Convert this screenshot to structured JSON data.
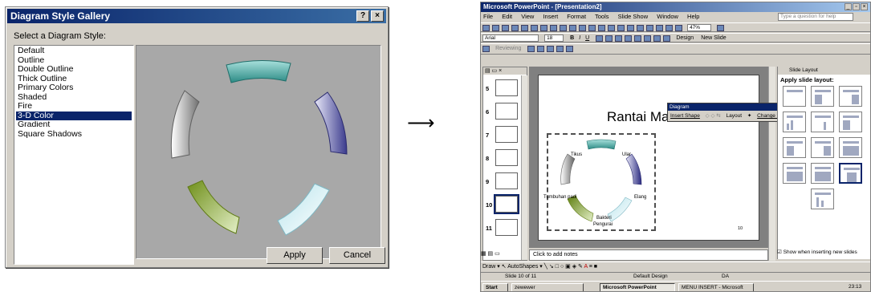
{
  "dialog": {
    "title": "Diagram Style Gallery",
    "help_glyph": "?",
    "close_glyph": "×",
    "prompt": "Select a Diagram Style:",
    "styles": [
      "Default",
      "Outline",
      "Double Outline",
      "Thick Outline",
      "Primary Colors",
      "Shaded",
      "Fire",
      "3-D Color",
      "Gradient",
      "Square Shadows"
    ],
    "selected_style": "3-D Color",
    "apply_label": "Apply",
    "cancel_label": "Cancel"
  },
  "arrow_glyph": "⟶",
  "ppt": {
    "title": "Microsoft PowerPoint - [Presentation2]",
    "window_buttons": [
      "_",
      "▫",
      "×"
    ],
    "menu": [
      "File",
      "Edit",
      "View",
      "Insert",
      "Format",
      "Tools",
      "Slide Show",
      "Window",
      "Help"
    ],
    "help_placeholder": "Type a question for help",
    "zoom": "47%",
    "font_name": "Arial",
    "font_size": "18",
    "design_label": "Design",
    "new_slide_label": "New Slide",
    "reviewing_label": "Reviewing",
    "slide_numbers": [
      "5",
      "6",
      "7",
      "8",
      "9",
      "10",
      "11"
    ],
    "selected_slide": "10",
    "slide": {
      "title": "Rantai Makanan",
      "number": "10",
      "labels": [
        "Tikus",
        "Ular",
        "Tumbuhan padi",
        "Elang",
        "Bakteri",
        "Pengurai"
      ]
    },
    "diagram_toolbar": {
      "title": "Diagram",
      "insert_shape": "Insert Shape",
      "layout": "Layout",
      "change_to": "Change to"
    },
    "task_pane": {
      "title": "Slide Layout",
      "subtitle": "Apply slide layout:",
      "checkbox_label": "Show when inserting new slides"
    },
    "notes_placeholder": "Click to add notes",
    "draw_label": "Draw",
    "autoshapes_label": "AutoShapes",
    "status": {
      "slide": "Slide 10 of 11",
      "design": "Default Design",
      "lang_icon": "DA"
    },
    "taskbar": {
      "start": "Start",
      "items": [
        "zewewer",
        "Microsoft PowerPoint",
        "MENU INSERT - Microsoft"
      ],
      "clock": "23:13"
    }
  }
}
